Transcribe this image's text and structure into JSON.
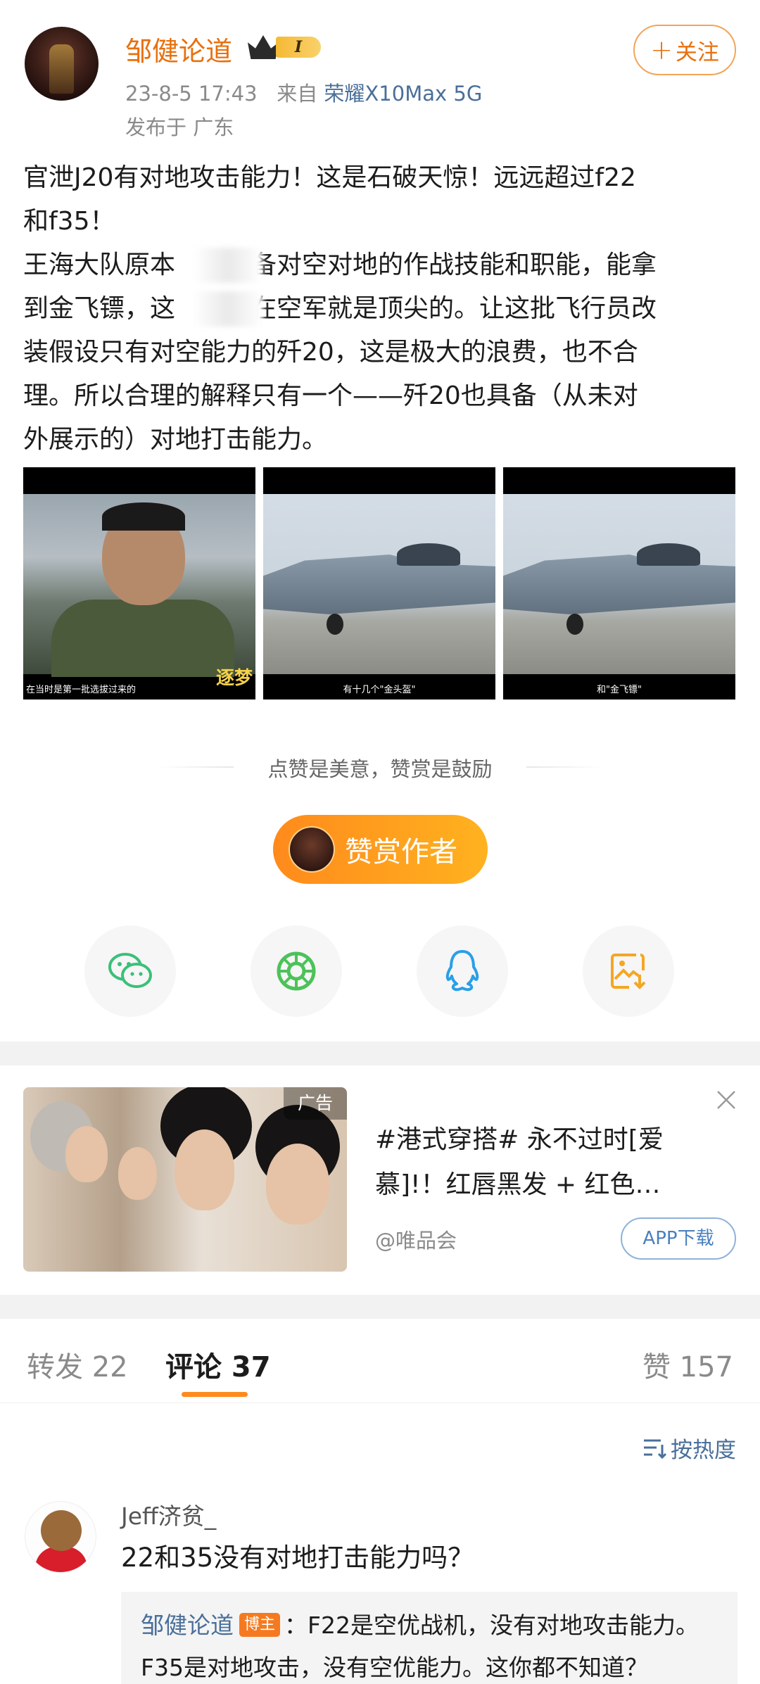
{
  "author": {
    "name": "邹健论道",
    "vip_level": "I",
    "date": "23-8-5 17:43",
    "source_prefix": "来自",
    "device": "荣耀X10Max 5G",
    "location": "发布于 广东"
  },
  "follow_button": {
    "plus": "+",
    "label": "关注"
  },
  "post": {
    "lines": [
      "官泄J20有对地攻击能力！这是石破天惊！远远超过f22",
      "和f35！",
      "王海大队原本　　　备对空对地的作战技能和职能，能拿",
      "到金飞镖，这　　　在空军就是顶尖的。让这批飞行员改",
      "装假设只有对空能力的歼20，这是极大的浪费，也不合",
      "理。所以合理的解释只有一个——歼20也具备（从未对",
      "外展示的）对地打击能力。"
    ]
  },
  "images": [
    {
      "caption": "在当时是第一批选拔过来的",
      "watermark": "逐梦"
    },
    {
      "caption": "有十几个\"金头盔\""
    },
    {
      "caption": "和\"金飞镖\""
    }
  ],
  "reward": {
    "tip": "点赞是美意，赞赏是鼓励",
    "button_label": "赞赏作者"
  },
  "share": {
    "icons": [
      "wechat-icon",
      "moments-icon",
      "qq-icon",
      "save-image-icon"
    ],
    "colors": {
      "wechat": "#3cbf7a",
      "moments": "#4cc25a",
      "qq": "#2a9fe8",
      "save": "#f5a623"
    }
  },
  "ad": {
    "tag": "广告",
    "title": "#港式穿搭# 永不过时[爱慕]!！红唇黑发 + 红色…",
    "source": "@唯品会",
    "download_label": "APP下载"
  },
  "tabs": {
    "repost": "转发 22",
    "comment": "评论 37",
    "like": "赞 157"
  },
  "sort_label": "按热度",
  "comment": {
    "user": "Jeff济贫_",
    "text": "22和35没有对地打击能力吗？",
    "reply": {
      "author": "邹健论道",
      "badge": "博主",
      "text_line1": "：F22是空优战机，没有对地攻击能力。",
      "text_line2": "F35是对地攻击，没有空优能力。这你都不知道？"
    }
  },
  "colors": {
    "accent_orange": "#e8700e",
    "link_blue": "#4a6f9a",
    "tab_indicator": "#ff8a1c"
  }
}
